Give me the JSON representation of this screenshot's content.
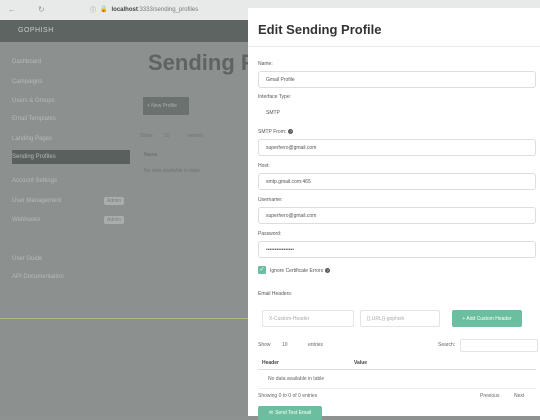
{
  "browser": {
    "url_scheme": "localhost",
    "url_path": ":3333/sending_profiles"
  },
  "background": {
    "brand": "GOPHISH",
    "sidebar": [
      "Dashboard",
      "Campaigns",
      "Users & Groups",
      "Email Templates",
      "Landing Pages",
      "Sending Profiles",
      "Account Settings",
      "User Management",
      "Webhooks",
      "User Guide",
      "API Documentation"
    ],
    "badges": [
      "Admin",
      "Admin"
    ],
    "heading": "Sending P",
    "button": "+ New Profile",
    "show_label": "Show",
    "show_count": "10",
    "entries_label": "entries",
    "name_header": "Name",
    "no_data": "No data available in table"
  },
  "modal": {
    "title": "Edit Sending Profile",
    "name_label": "Name:",
    "name_value": "Gmail Profile",
    "interface_label": "Interface Type:",
    "interface_value": "SMTP",
    "from_label": "SMTP From:",
    "from_value": "superhero@gmail.com",
    "host_label": "Host:",
    "host_value": "smtp.gmail.com:465",
    "username_label": "Username:",
    "username_value": "superhero@gmail.com",
    "password_label": "Password:",
    "password_value": "••••••••••••••••",
    "ignore_cert_label": "Ignore Certificate Errors",
    "email_headers_label": "Email Headers:",
    "header_placeholder": "X-Custom-Header",
    "value_placeholder": "{{.URL}}-gophish",
    "add_header_label": "+ Add Custom Header",
    "show_label": "Show",
    "show_count": "10",
    "entries_label": "entries",
    "search_label": "Search:",
    "col_header": "Header",
    "col_value": "Value",
    "no_data": "No data available in table",
    "showing_text": "Showing 0 to 0 of 0 entries",
    "prev_label": "Previous",
    "next_label": "Next",
    "send_test_label": "Send Test Email"
  }
}
